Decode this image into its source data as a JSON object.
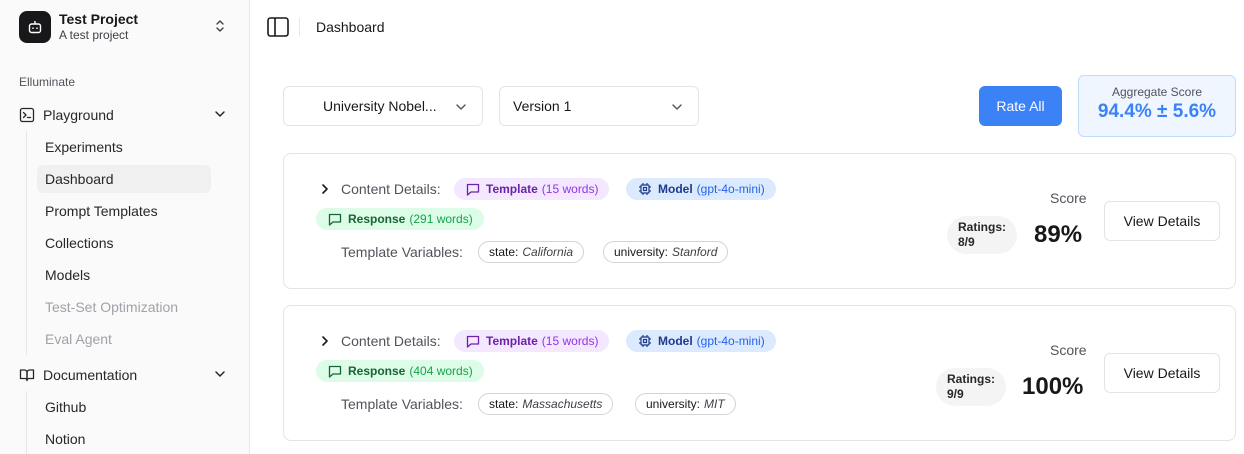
{
  "project": {
    "name": "Test Project",
    "description": "A test project"
  },
  "sidebar": {
    "group_label": "Elluminate",
    "playground": {
      "label": "Playground",
      "items": [
        {
          "label": "Experiments"
        },
        {
          "label": "Dashboard"
        },
        {
          "label": "Prompt Templates"
        },
        {
          "label": "Collections"
        },
        {
          "label": "Models"
        },
        {
          "label": "Test-Set Optimization"
        },
        {
          "label": "Eval Agent"
        }
      ]
    },
    "documentation": {
      "label": "Documentation",
      "items": [
        {
          "label": "Github"
        },
        {
          "label": "Notion"
        }
      ]
    }
  },
  "header": {
    "breadcrumb": "Dashboard"
  },
  "controls": {
    "collection_select": "University Nobel...",
    "version_select": "Version 1",
    "rate_all": "Rate All",
    "aggregate_label": "Aggregate Score",
    "aggregate_value": "94.4% ± 5.6%"
  },
  "cards": [
    {
      "content_details_label": "Content Details:",
      "template_label": "Template",
      "template_count": "(15 words)",
      "model_label": "Model",
      "model_name": "(gpt-4o-mini)",
      "response_label": "Response",
      "response_count": "(291 words)",
      "template_variables_label": "Template Variables:",
      "variables": [
        {
          "key": "state:",
          "value": "California"
        },
        {
          "key": "university:",
          "value": "Stanford"
        }
      ],
      "score_label": "Score",
      "ratings_line1": "Ratings:",
      "ratings_line2": "8/9",
      "score": "89%",
      "view_details": "View Details"
    },
    {
      "content_details_label": "Content Details:",
      "template_label": "Template",
      "template_count": "(15 words)",
      "model_label": "Model",
      "model_name": "(gpt-4o-mini)",
      "response_label": "Response",
      "response_count": "(404 words)",
      "template_variables_label": "Template Variables:",
      "variables": [
        {
          "key": "state:",
          "value": "Massachusetts"
        },
        {
          "key": "university:",
          "value": "MIT"
        }
      ],
      "score_label": "Score",
      "ratings_line1": "Ratings:",
      "ratings_line2": "9/9",
      "score": "100%",
      "view_details": "View Details"
    }
  ],
  "colors": {
    "accent": "#3b82f6",
    "template_pill": "#f3e8ff",
    "model_pill": "#dbeafe",
    "response_pill": "#dcfce7"
  },
  "icons": [
    "robot-icon",
    "chevrons-up-down-icon",
    "terminal-square-icon",
    "chevron-down-icon",
    "book-open-icon",
    "sidebar-toggle-icon",
    "chevron-right-icon",
    "message-square-icon",
    "cpu-icon"
  ]
}
